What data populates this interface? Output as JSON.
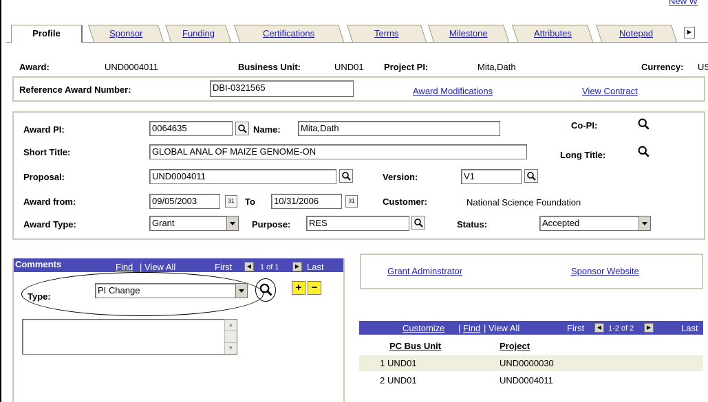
{
  "top_link": "New W",
  "tabs": [
    "Profile",
    "Sponsor",
    "Funding",
    "Certifications",
    "Terms",
    "Milestone",
    "Attributes",
    "Notepad"
  ],
  "header": {
    "award_label": "Award:",
    "award_value": "UND0004011",
    "business_unit_label": "Business Unit:",
    "business_unit_value": "UND01",
    "project_pi_label": "Project PI:",
    "project_pi_value": "Mita,Dath",
    "currency_label": "Currency:",
    "currency_value": "US"
  },
  "reference": {
    "label": "Reference Award Number:",
    "value": "DBI-0321565",
    "award_modifications": "Award Modifications",
    "view_contract": "View Contract"
  },
  "main": {
    "award_pi_label": "Award PI:",
    "award_pi_value": "0064635",
    "name_label": "Name:",
    "name_value": "Mita,Dath",
    "copi_label": "Co-PI:",
    "short_title_label": "Short Title:",
    "short_title_value": "GLOBAL ANAL OF MAIZE GENOME-ON",
    "long_title_label": "Long Title:",
    "proposal_label": "Proposal:",
    "proposal_value": "UND0004011",
    "version_label": "Version:",
    "version_value": "V1",
    "award_from_label": "Award from:",
    "award_from_value": "09/05/2003",
    "to_label": "To",
    "to_value": "10/31/2006",
    "customer_label": "Customer:",
    "customer_value": "National Science Foundation",
    "award_type_label": "Award Type:",
    "award_type_value": "Grant",
    "purpose_label": "Purpose:",
    "purpose_value": "RES",
    "status_label": "Status:",
    "status_value": "Accepted"
  },
  "comments": {
    "title": "Comments",
    "find": "Find",
    "view_all": "| View All",
    "first": "First",
    "pager": "1 of 1",
    "last": "Last",
    "type_label": "Type:",
    "type_value": "PI Change"
  },
  "links_box": {
    "grant_admin": "Grant Adminstrator",
    "sponsor_website": "Sponsor Website"
  },
  "project_grid": {
    "customize": "Customize",
    "find": "Find",
    "view_all": "| View All",
    "first": "First",
    "pager": "1-2 of 2",
    "last": "Last",
    "col_bus_unit": "PC Bus Unit",
    "col_project": "Project",
    "rows": [
      {
        "num": "1",
        "bus_unit": "UND01",
        "project": "UND0000030"
      },
      {
        "num": "2",
        "bus_unit": "UND01",
        "project": "UND0004011"
      }
    ]
  }
}
